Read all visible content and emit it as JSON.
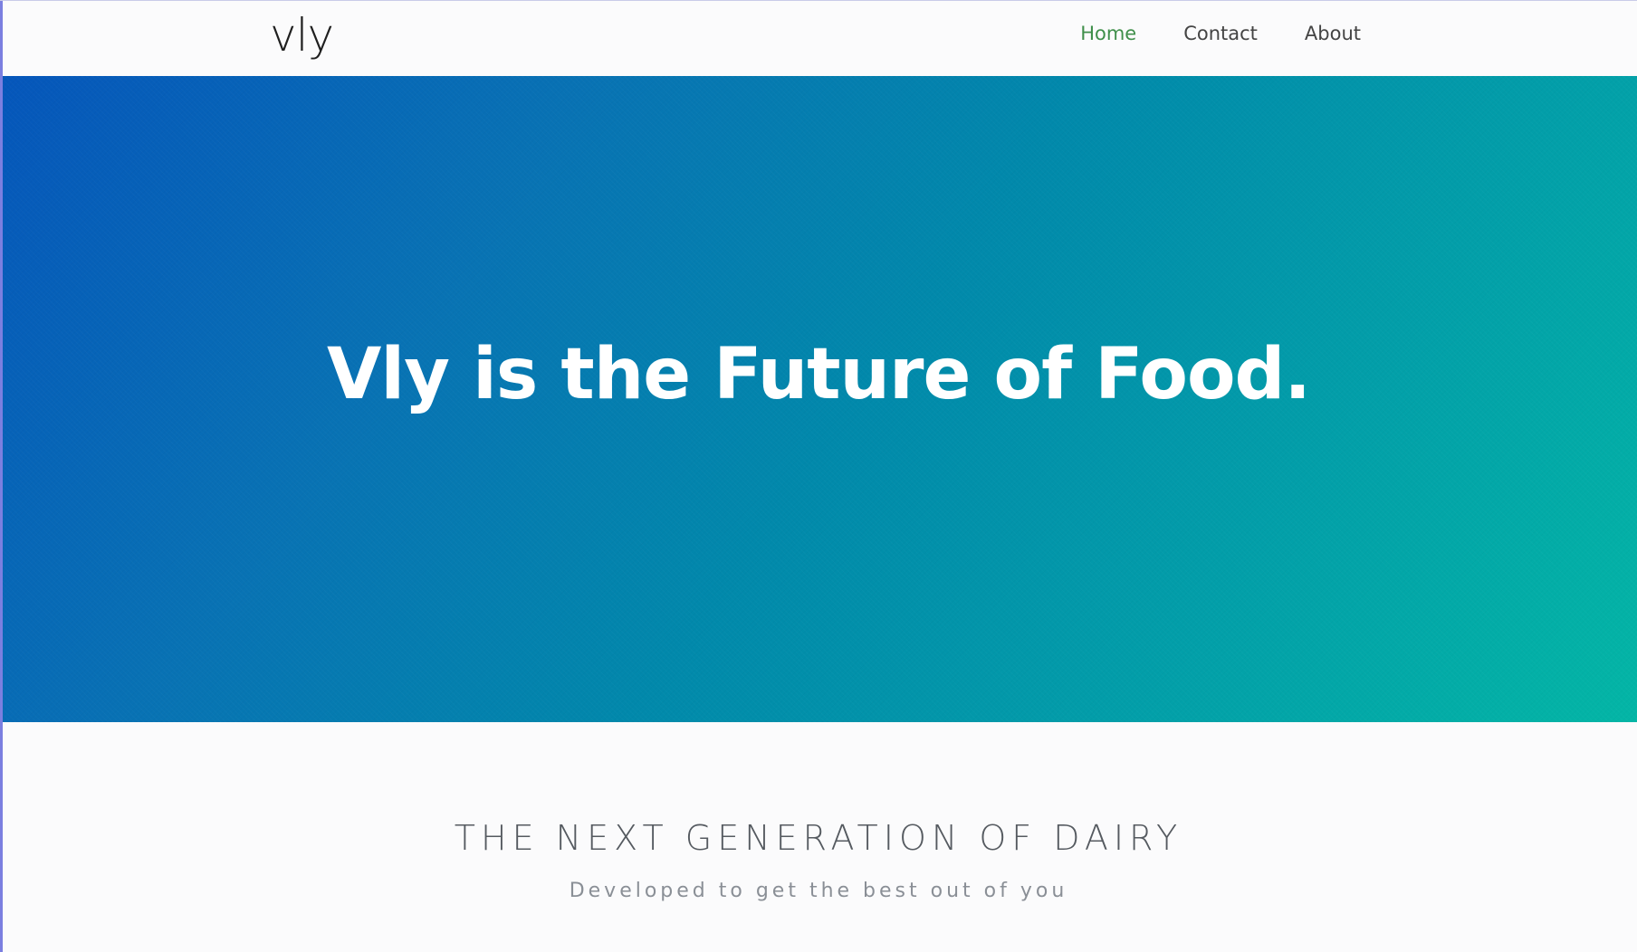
{
  "header": {
    "logo": "vly",
    "nav": [
      {
        "label": "Home",
        "active": true
      },
      {
        "label": "Contact",
        "active": false
      },
      {
        "label": "About",
        "active": false
      }
    ]
  },
  "hero": {
    "title": "Vly is the Future of Food.",
    "gradient_colors": [
      "#0556bb",
      "#0189ab",
      "#03b6a6"
    ]
  },
  "section": {
    "title": "THE NEXT GENERATION OF DAIRY",
    "subtitle": "Developed to get the best out of you"
  },
  "colors": {
    "nav_active": "#3f8f4a",
    "nav_text": "#444444",
    "hero_text": "#ffffff"
  }
}
